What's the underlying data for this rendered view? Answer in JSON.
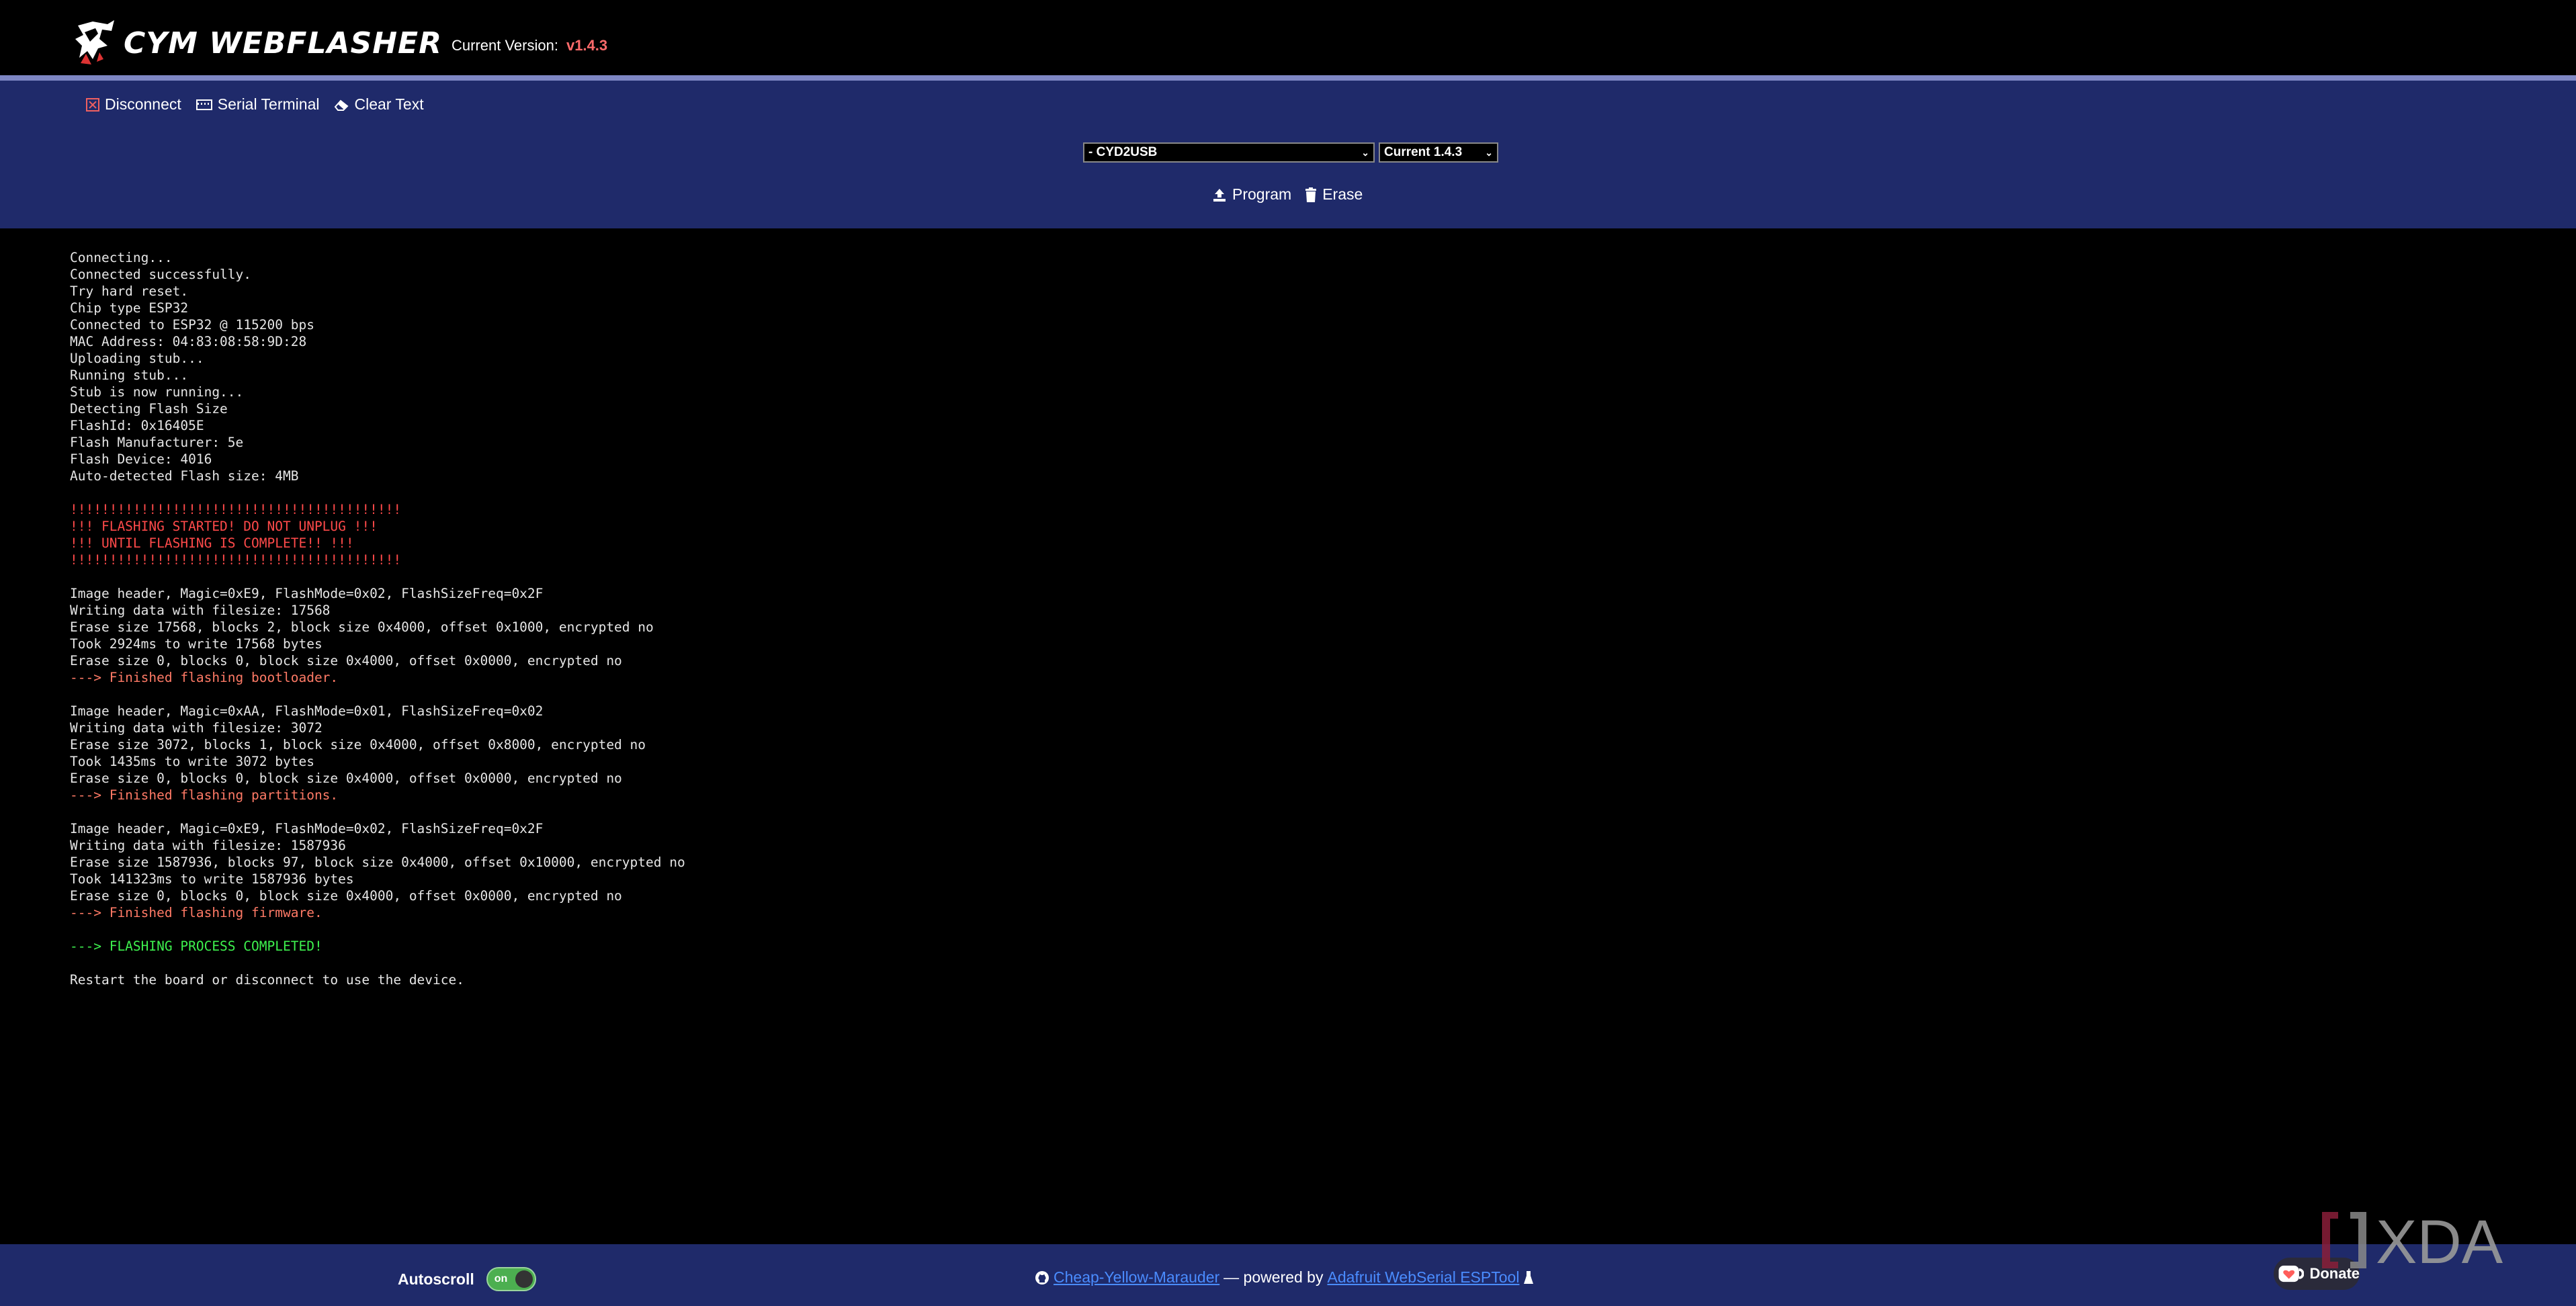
{
  "header": {
    "logo_text": "CYM WEBFLASHER",
    "version_label": "Current Version:",
    "version_value": "v1.4.3"
  },
  "toolbar": {
    "disconnect": "Disconnect",
    "serial_terminal": "Serial Terminal",
    "clear_text": "Clear Text"
  },
  "controls": {
    "board_select": "- CYD2USB",
    "version_select": "Current 1.4.3",
    "program": "Program",
    "erase": "Erase"
  },
  "console": [
    {
      "text": "Connecting...",
      "style": ""
    },
    {
      "text": "Connected successfully.",
      "style": ""
    },
    {
      "text": "Try hard reset.",
      "style": ""
    },
    {
      "text": "Chip type ESP32",
      "style": ""
    },
    {
      "text": "Connected to ESP32 @ 115200 bps",
      "style": ""
    },
    {
      "text": "MAC Address: 04:83:08:58:9D:28",
      "style": ""
    },
    {
      "text": "Uploading stub...",
      "style": ""
    },
    {
      "text": "Running stub...",
      "style": ""
    },
    {
      "text": "Stub is now running...",
      "style": ""
    },
    {
      "text": "Detecting Flash Size",
      "style": ""
    },
    {
      "text": "FlashId: 0x16405E",
      "style": ""
    },
    {
      "text": "Flash Manufacturer: 5e",
      "style": ""
    },
    {
      "text": "Flash Device: 4016",
      "style": ""
    },
    {
      "text": "Auto-detected Flash size: 4MB",
      "style": ""
    },
    {
      "text": "",
      "style": ""
    },
    {
      "text": "!!!!!!!!!!!!!!!!!!!!!!!!!!!!!!!!!!!!!!!!!!",
      "style": "red"
    },
    {
      "text": "!!! FLASHING STARTED! DO NOT UNPLUG !!!",
      "style": "red"
    },
    {
      "text": "!!! UNTIL FLASHING IS COMPLETE!! !!!",
      "style": "red"
    },
    {
      "text": "!!!!!!!!!!!!!!!!!!!!!!!!!!!!!!!!!!!!!!!!!!",
      "style": "red"
    },
    {
      "text": "",
      "style": ""
    },
    {
      "text": "Image header, Magic=0xE9, FlashMode=0x02, FlashSizeFreq=0x2F",
      "style": ""
    },
    {
      "text": "Writing data with filesize: 17568",
      "style": ""
    },
    {
      "text": "Erase size 17568, blocks 2, block size 0x4000, offset 0x1000, encrypted no",
      "style": ""
    },
    {
      "text": "Took 2924ms to write 17568 bytes",
      "style": ""
    },
    {
      "text": "Erase size 0, blocks 0, block size 0x4000, offset 0x0000, encrypted no",
      "style": ""
    },
    {
      "text": "---> Finished flashing bootloader.",
      "style": "orange"
    },
    {
      "text": "",
      "style": ""
    },
    {
      "text": "Image header, Magic=0xAA, FlashMode=0x01, FlashSizeFreq=0x02",
      "style": ""
    },
    {
      "text": "Writing data with filesize: 3072",
      "style": ""
    },
    {
      "text": "Erase size 3072, blocks 1, block size 0x4000, offset 0x8000, encrypted no",
      "style": ""
    },
    {
      "text": "Took 1435ms to write 3072 bytes",
      "style": ""
    },
    {
      "text": "Erase size 0, blocks 0, block size 0x4000, offset 0x0000, encrypted no",
      "style": ""
    },
    {
      "text": "---> Finished flashing partitions.",
      "style": "orange"
    },
    {
      "text": "",
      "style": ""
    },
    {
      "text": "Image header, Magic=0xE9, FlashMode=0x02, FlashSizeFreq=0x2F",
      "style": ""
    },
    {
      "text": "Writing data with filesize: 1587936",
      "style": ""
    },
    {
      "text": "Erase size 1587936, blocks 97, block size 0x4000, offset 0x10000, encrypted no",
      "style": ""
    },
    {
      "text": "Took 141323ms to write 1587936 bytes",
      "style": ""
    },
    {
      "text": "Erase size 0, blocks 0, block size 0x4000, offset 0x0000, encrypted no",
      "style": ""
    },
    {
      "text": "---> Finished flashing firmware.",
      "style": "orange"
    },
    {
      "text": "",
      "style": ""
    },
    {
      "text": "---> FLASHING PROCESS COMPLETED!",
      "style": "green"
    },
    {
      "text": "",
      "style": ""
    },
    {
      "text": "Restart the board or disconnect to use the device.",
      "style": ""
    }
  ],
  "footer": {
    "autoscroll_label": "Autoscroll",
    "toggle_label": "on",
    "link1": "Cheap-Yellow-Marauder",
    "powered_by": "— powered by",
    "link2": "Adafruit WebSerial ESPTool",
    "donate": "Donate"
  },
  "watermark": "XDA",
  "colors": {
    "nav_bg": "#1f2a6a",
    "version": "#ff6b6b",
    "warning": "#ff4a4a",
    "finished": "#ff7a66",
    "success": "#3ef24e",
    "link": "#4a8cff",
    "toggle_on": "#4caf50"
  },
  "icons": {
    "logo": "dragon-claw-icon",
    "disconnect": "close-box-icon",
    "serial_terminal": "keyboard-icon",
    "clear_text": "eraser-icon",
    "program": "upload-icon",
    "erase": "trash-icon",
    "github": "github-icon",
    "flask": "flask-icon",
    "donate": "ko-fi-heart-icon"
  }
}
